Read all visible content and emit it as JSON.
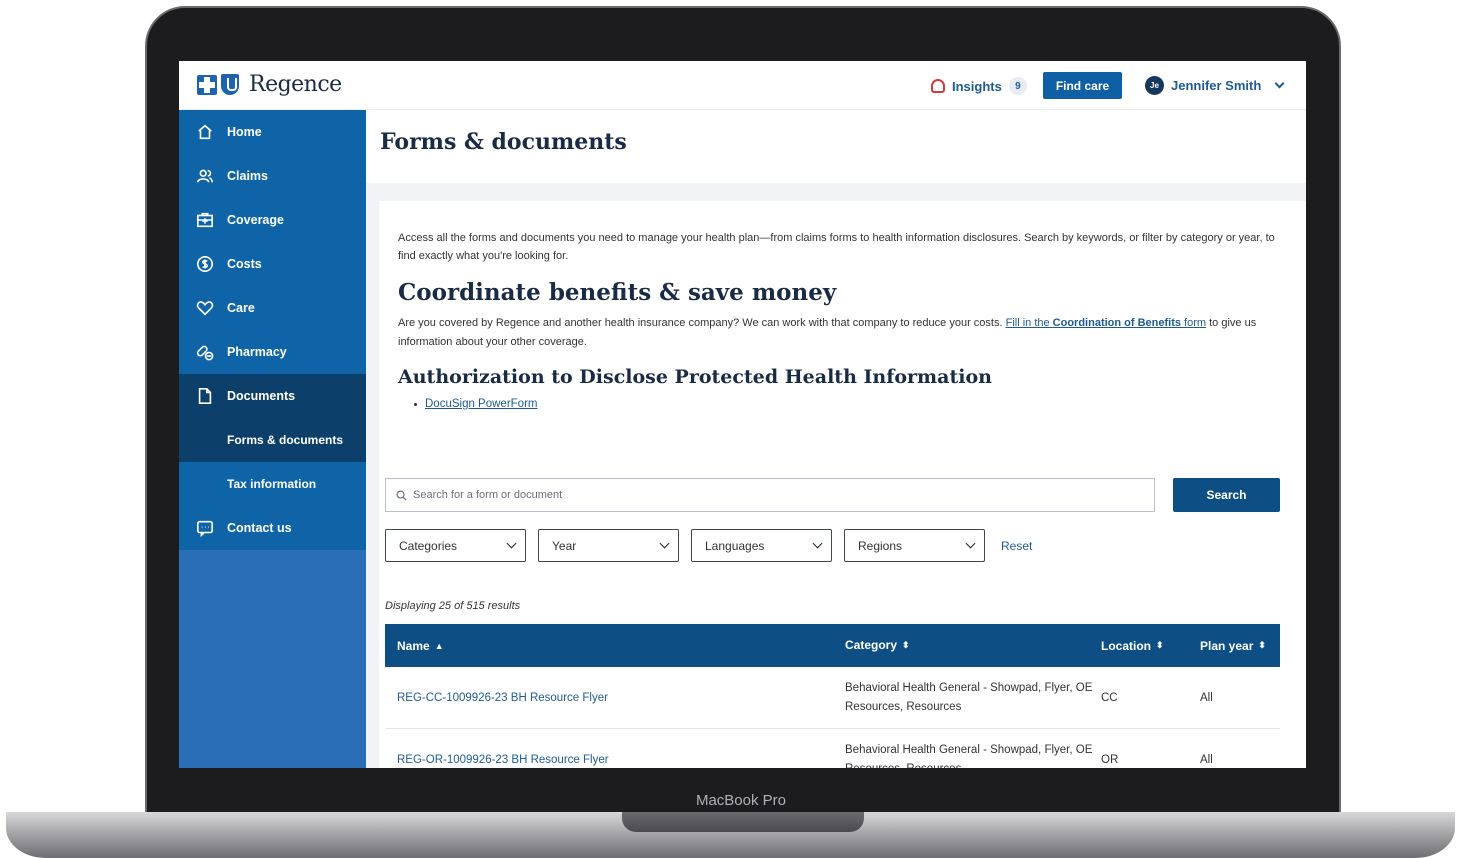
{
  "device": {
    "bezel_label": "MacBook Pro"
  },
  "header": {
    "logo_text": "Regence",
    "insights_label": "Insights",
    "insights_count": "9",
    "find_care_label": "Find care",
    "user_initials": "Je",
    "user_name": "Jennifer Smith"
  },
  "sidebar": {
    "items": [
      {
        "label": "Home",
        "icon": "home-icon"
      },
      {
        "label": "Claims",
        "icon": "people-icon"
      },
      {
        "label": "Coverage",
        "icon": "medical-kit-icon"
      },
      {
        "label": "Costs",
        "icon": "dollar-circle-icon"
      },
      {
        "label": "Care",
        "icon": "heart-icon"
      },
      {
        "label": "Pharmacy",
        "icon": "pill-icon"
      },
      {
        "label": "Documents",
        "icon": "document-icon"
      }
    ],
    "sub_items": [
      {
        "label": "Forms & documents"
      },
      {
        "label": "Tax information"
      }
    ],
    "contact": {
      "label": "Contact us",
      "icon": "chat-icon"
    }
  },
  "main": {
    "title": "Forms & documents",
    "intro": "Access all the forms and documents you need to manage your health plan—from claims forms to health information disclosures. Search by keywords, or filter by category or year, to find exactly what you're looking for.",
    "section1": {
      "heading": "Coordinate benefits & save money",
      "text": "Are you covered by Regence and another health insurance company? We can work with that company to reduce your costs.",
      "link_pre": "Fill in the ",
      "link_bold": "Coordination of Benefits",
      "link_post": " form",
      "text_after": "to give us information about your other coverage."
    },
    "section2": {
      "heading": "Authorization to Disclose Protected Health Information",
      "link": "DocuSign PowerForm"
    },
    "search": {
      "placeholder": "Search for a form or document",
      "button": "Search"
    },
    "filters": [
      "Categories",
      "Year",
      "Languages",
      "Regions"
    ],
    "reset": "Reset",
    "results_text": "Displaying 25 of 515 results",
    "table": {
      "columns": [
        "Name",
        "Category",
        "Location",
        "Plan year"
      ],
      "rows": [
        {
          "name": "REG-CC-1009926-23 BH Resource Flyer",
          "category": "Behavioral Health General - Showpad, Flyer, OE Resources, Resources",
          "location": "CC",
          "plan_year": "All"
        },
        {
          "name": "REG-OR-1009926-23 BH Resource Flyer",
          "category": "Behavioral Health General - Showpad, Flyer, OE Resources, Resources",
          "location": "OR",
          "plan_year": "All"
        }
      ]
    }
  },
  "colors": {
    "primary": "#0f64a8",
    "nav_active": "#0d3f6b",
    "button": "#0d4f85",
    "link": "#1e5b94"
  }
}
